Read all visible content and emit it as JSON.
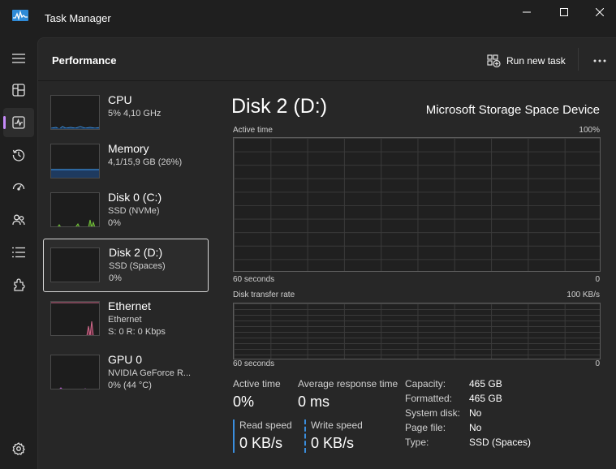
{
  "window": {
    "title": "Task Manager"
  },
  "header": {
    "title": "Performance",
    "run_new_task": "Run new task"
  },
  "devices": [
    {
      "name": "CPU",
      "line1": "5% 4,10 GHz",
      "line2": ""
    },
    {
      "name": "Memory",
      "line1": "4,1/15,9 GB (26%)",
      "line2": ""
    },
    {
      "name": "Disk 0 (C:)",
      "line1": "SSD (NVMe)",
      "line2": "0%"
    },
    {
      "name": "Disk 2 (D:)",
      "line1": "SSD (Spaces)",
      "line2": "0%"
    },
    {
      "name": "Ethernet",
      "line1": "Ethernet",
      "line2": "S: 0 R: 0 Kbps"
    },
    {
      "name": "GPU 0",
      "line1": "NVIDIA GeForce R...",
      "line2": "0% (44 °C)"
    }
  ],
  "detail": {
    "title": "Disk 2 (D:)",
    "model": "Microsoft Storage Space Device",
    "graph1": {
      "label": "Active time",
      "max": "100%",
      "time": "60 seconds",
      "min": "0"
    },
    "graph2": {
      "label": "Disk transfer rate",
      "max": "100 KB/s",
      "time": "60 seconds",
      "min": "0"
    },
    "stats": {
      "active_time_label": "Active time",
      "active_time_value": "0%",
      "avg_response_label": "Average response time",
      "avg_response_value": "0 ms",
      "read_speed_label": "Read speed",
      "read_speed_value": "0 KB/s",
      "write_speed_label": "Write speed",
      "write_speed_value": "0 KB/s"
    },
    "properties": [
      {
        "key": "Capacity:",
        "value": "465 GB"
      },
      {
        "key": "Formatted:",
        "value": "465 GB"
      },
      {
        "key": "System disk:",
        "value": "No"
      },
      {
        "key": "Page file:",
        "value": "No"
      },
      {
        "key": "Type:",
        "value": "SSD (Spaces)"
      }
    ]
  },
  "colors": {
    "accent": "#c58af9",
    "cpu": "#3a8ede",
    "memory": "#9c66e8",
    "disk": "#74c23c",
    "ethernet": "#d16a8c",
    "gpu": "#b65ccf",
    "read_speed": "#3a8ede"
  },
  "icons": {
    "rail": [
      "hamburger-icon",
      "processes-icon",
      "performance-icon",
      "app-history-icon",
      "startup-apps-icon",
      "users-icon",
      "details-icon",
      "services-icon",
      "settings-icon"
    ]
  }
}
